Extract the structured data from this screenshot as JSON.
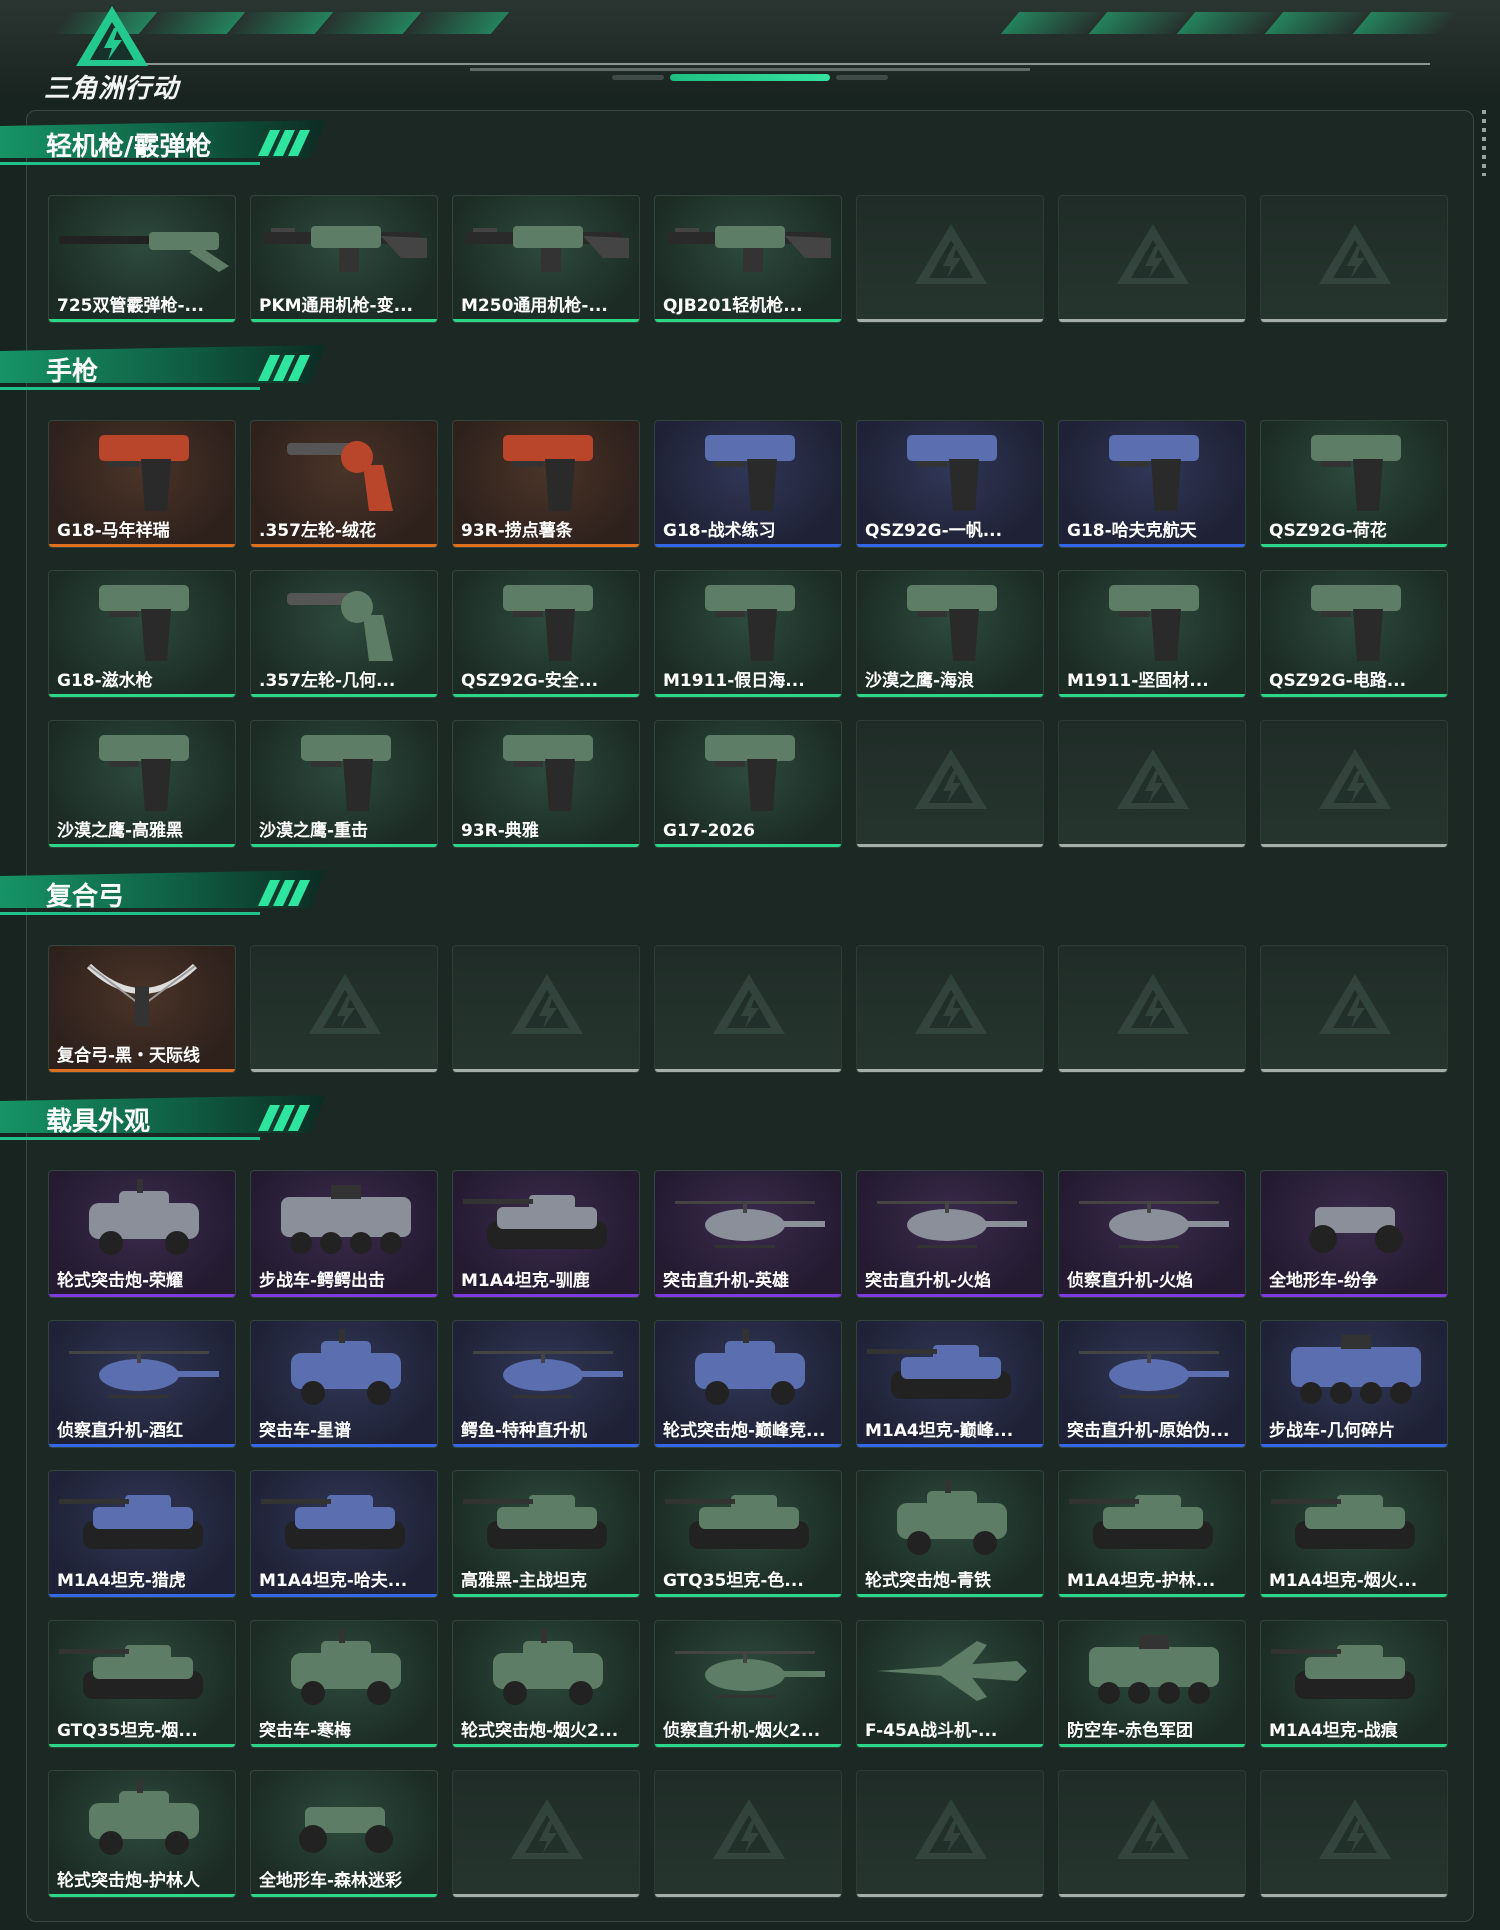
{
  "app": {
    "logo_text": "三角洲行动"
  },
  "sections": [
    {
      "title": "轻机枪/霰弹枪",
      "items": [
        {
          "label": "725双管霰弹枪-...",
          "rarity": "green",
          "icon": "long-gun-icon"
        },
        {
          "label": "PKM通用机枪-变...",
          "rarity": "green",
          "icon": "machine-gun-icon"
        },
        {
          "label": "M250通用机枪-...",
          "rarity": "green",
          "icon": "machine-gun-icon"
        },
        {
          "label": "QJB201轻机枪...",
          "rarity": "green",
          "icon": "machine-gun-icon"
        },
        {
          "label": "",
          "rarity": "empty"
        },
        {
          "label": "",
          "rarity": "empty"
        },
        {
          "label": "",
          "rarity": "empty"
        }
      ]
    },
    {
      "title": "手枪",
      "items": [
        {
          "label": "G18-马年祥瑞",
          "rarity": "gold",
          "icon": "pistol-icon"
        },
        {
          "label": ".357左轮-绒花",
          "rarity": "gold",
          "icon": "revolver-icon"
        },
        {
          "label": "93R-捞点薯条",
          "rarity": "gold",
          "icon": "pistol-icon"
        },
        {
          "label": "G18-战术练习",
          "rarity": "blue",
          "icon": "pistol-icon"
        },
        {
          "label": "QSZ92G-一帆...",
          "rarity": "blue",
          "icon": "pistol-icon"
        },
        {
          "label": "G18-哈夫克航天",
          "rarity": "blue",
          "icon": "pistol-icon"
        },
        {
          "label": "QSZ92G-荷花",
          "rarity": "green",
          "icon": "pistol-icon"
        },
        {
          "label": "G18-滋水枪",
          "rarity": "green",
          "icon": "pistol-icon"
        },
        {
          "label": ".357左轮-几何...",
          "rarity": "green",
          "icon": "revolver-icon"
        },
        {
          "label": "QSZ92G-安全...",
          "rarity": "green",
          "icon": "pistol-icon"
        },
        {
          "label": "M1911-假日海...",
          "rarity": "green",
          "icon": "pistol-icon"
        },
        {
          "label": "沙漠之鹰-海浪",
          "rarity": "green",
          "icon": "pistol-icon"
        },
        {
          "label": "M1911-坚固材...",
          "rarity": "green",
          "icon": "pistol-icon"
        },
        {
          "label": "QSZ92G-电路...",
          "rarity": "green",
          "icon": "pistol-icon"
        },
        {
          "label": "沙漠之鹰-高雅黑",
          "rarity": "green",
          "icon": "pistol-icon"
        },
        {
          "label": "沙漠之鹰-重击",
          "rarity": "green",
          "icon": "pistol-icon"
        },
        {
          "label": "93R-典雅",
          "rarity": "green",
          "icon": "pistol-icon"
        },
        {
          "label": "G17-2026",
          "rarity": "green",
          "icon": "pistol-icon"
        },
        {
          "label": "",
          "rarity": "empty"
        },
        {
          "label": "",
          "rarity": "empty"
        },
        {
          "label": "",
          "rarity": "empty"
        }
      ]
    },
    {
      "title": "复合弓",
      "items": [
        {
          "label": "复合弓-黑・天际线",
          "rarity": "gold",
          "icon": "bow-icon"
        },
        {
          "label": "",
          "rarity": "empty"
        },
        {
          "label": "",
          "rarity": "empty"
        },
        {
          "label": "",
          "rarity": "empty"
        },
        {
          "label": "",
          "rarity": "empty"
        },
        {
          "label": "",
          "rarity": "empty"
        },
        {
          "label": "",
          "rarity": "empty"
        }
      ]
    },
    {
      "title": "载具外观",
      "items": [
        {
          "label": "轮式突击炮-荣耀",
          "rarity": "purple",
          "icon": "armored-car-icon"
        },
        {
          "label": "步战车-鳄鳄出击",
          "rarity": "purple",
          "icon": "apc-icon"
        },
        {
          "label": "M1A4坦克-驯鹿",
          "rarity": "purple",
          "icon": "tank-icon"
        },
        {
          "label": "突击直升机-英雄",
          "rarity": "purple",
          "icon": "helicopter-icon"
        },
        {
          "label": "突击直升机-火焰",
          "rarity": "purple",
          "icon": "helicopter-icon"
        },
        {
          "label": "侦察直升机-火焰",
          "rarity": "purple",
          "icon": "helicopter-icon"
        },
        {
          "label": "全地形车-纷争",
          "rarity": "purple",
          "icon": "atv-icon"
        },
        {
          "label": "侦察直升机-酒红",
          "rarity": "blue",
          "icon": "helicopter-icon"
        },
        {
          "label": "突击车-星谱",
          "rarity": "blue",
          "icon": "armored-car-icon"
        },
        {
          "label": "鳄鱼-特种直升机",
          "rarity": "blue",
          "icon": "helicopter-icon"
        },
        {
          "label": "轮式突击炮-巅峰竞...",
          "rarity": "blue",
          "icon": "armored-car-icon"
        },
        {
          "label": "M1A4坦克-巅峰...",
          "rarity": "blue",
          "icon": "tank-icon"
        },
        {
          "label": "突击直升机-原始伪...",
          "rarity": "blue",
          "icon": "helicopter-icon"
        },
        {
          "label": "步战车-几何碎片",
          "rarity": "blue",
          "icon": "apc-icon"
        },
        {
          "label": "M1A4坦克-猎虎",
          "rarity": "blue",
          "icon": "tank-icon"
        },
        {
          "label": "M1A4坦克-哈夫...",
          "rarity": "blue",
          "icon": "tank-icon"
        },
        {
          "label": "高雅黑-主战坦克",
          "rarity": "green",
          "icon": "tank-icon"
        },
        {
          "label": "GTQ35坦克-色...",
          "rarity": "green",
          "icon": "tank-icon"
        },
        {
          "label": "轮式突击炮-青铁",
          "rarity": "green",
          "icon": "armored-car-icon"
        },
        {
          "label": "M1A4坦克-护林...",
          "rarity": "green",
          "icon": "tank-icon"
        },
        {
          "label": "M1A4坦克-烟火...",
          "rarity": "green",
          "icon": "tank-icon"
        },
        {
          "label": "GTQ35坦克-烟...",
          "rarity": "green",
          "icon": "tank-icon"
        },
        {
          "label": "突击车-寒梅",
          "rarity": "green",
          "icon": "armored-car-icon"
        },
        {
          "label": "轮式突击炮-烟火2...",
          "rarity": "green",
          "icon": "armored-car-icon"
        },
        {
          "label": "侦察直升机-烟火2...",
          "rarity": "green",
          "icon": "helicopter-icon"
        },
        {
          "label": "F-45A战斗机-...",
          "rarity": "green",
          "icon": "jet-icon"
        },
        {
          "label": "防空车-赤色军团",
          "rarity": "green",
          "icon": "apc-icon"
        },
        {
          "label": "M1A4坦克-战痕",
          "rarity": "green",
          "icon": "tank-icon"
        },
        {
          "label": "轮式突击炮-护林人",
          "rarity": "green",
          "icon": "armored-car-icon"
        },
        {
          "label": "全地形车-森林迷彩",
          "rarity": "green",
          "icon": "atv-icon"
        },
        {
          "label": "",
          "rarity": "empty"
        },
        {
          "label": "",
          "rarity": "empty"
        },
        {
          "label": "",
          "rarity": "empty"
        },
        {
          "label": "",
          "rarity": "empty"
        },
        {
          "label": "",
          "rarity": "empty"
        }
      ]
    }
  ],
  "colors": {
    "gold": "#e0701e",
    "blue": "#3468e8",
    "purple": "#7e3be0",
    "green": "#2bd88a",
    "empty": "#a6aeab",
    "accent": "#1fbf84"
  }
}
